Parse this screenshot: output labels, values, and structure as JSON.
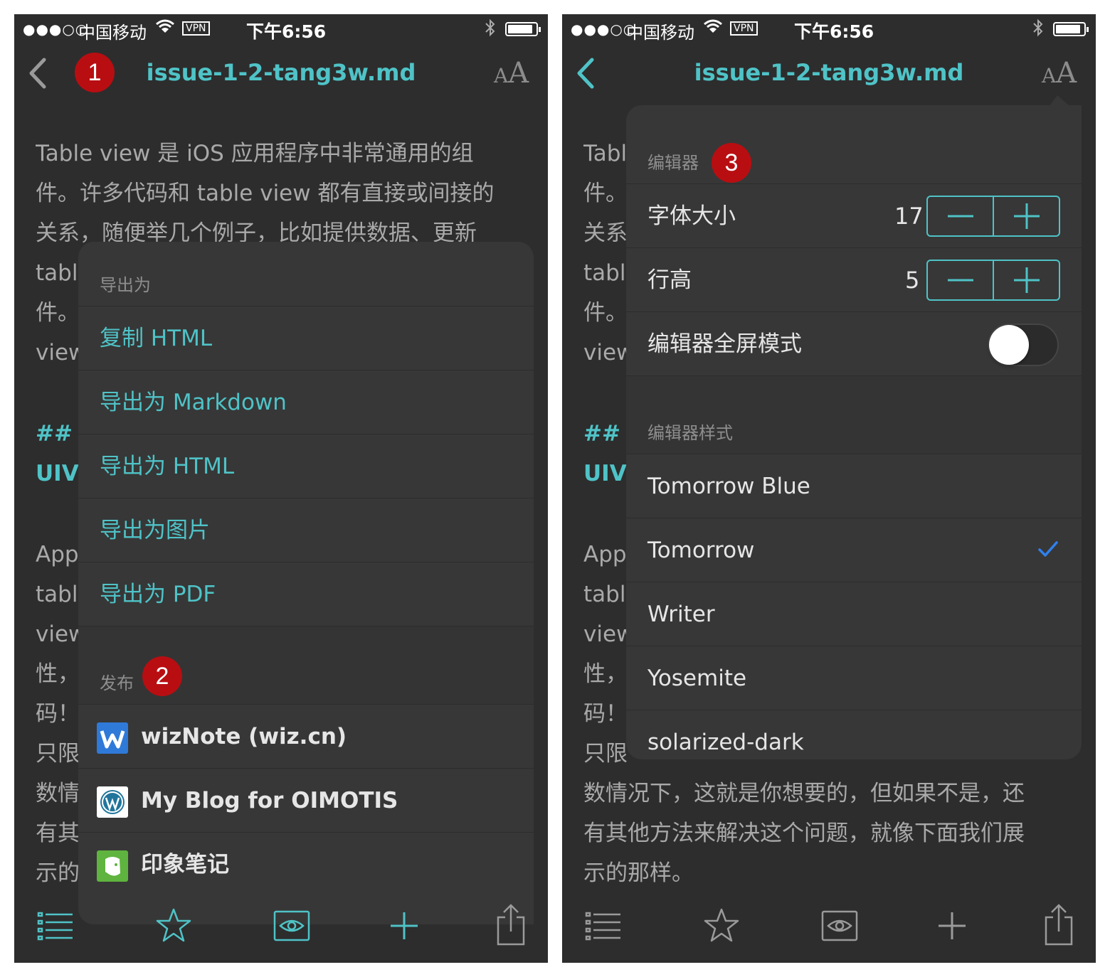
{
  "status": {
    "signal": "●●●○○",
    "carrier": "中国移动",
    "vpn": "VPN",
    "time": "下午6:56"
  },
  "nav": {
    "title": "issue-1-2-tang3w.md",
    "font_button_small": "A",
    "font_button_big": "A"
  },
  "badges": {
    "one": "1",
    "two": "2",
    "three": "3"
  },
  "colors": {
    "accent": "#4fc3c7",
    "badge": "#b80e12",
    "background": "#2d2d2d",
    "check": "#2f80ed"
  },
  "left": {
    "doc_lines": [
      "Table view 是 iOS 应用程序中非常通用的组",
      "件。许多代码和 table view 都有直接或间接的",
      "关系，随便举几个例子，比如提供数据、更新",
      "tabl",
      "件。",
      "view",
      "## U",
      "UIV",
      "App",
      "tabl",
      "view",
      "性，",
      "码！",
      "只限",
      "数情",
      "有其",
      "示的"
    ],
    "export_header": "导出为",
    "export_items": [
      "复制 HTML",
      "导出为 Markdown",
      "导出为 HTML",
      "导出为图片",
      "导出为 PDF"
    ],
    "publish_header": "发布",
    "publish_items": [
      {
        "label": "wizNote (wiz.cn)",
        "icon": "wiznote-icon"
      },
      {
        "label": "My Blog for OIMOTIS",
        "icon": "wordpress-icon"
      },
      {
        "label": "印象笔记",
        "icon": "evernote-icon"
      }
    ]
  },
  "right": {
    "doc_lines": [
      "Tabl",
      "件。",
      "关系",
      "tabl",
      "件。",
      "view",
      "## U",
      "UIV",
      "App",
      "tabl",
      "view",
      "性，",
      "码！",
      "只限",
      "数情况下，这就是你想要的，但如果不是，还",
      "有其他方法来解决这个问题，就像下面我们展",
      "示的那样。"
    ],
    "editor_header": "编辑器",
    "font_size_label": "字体大小",
    "font_size_value": "17",
    "line_height_label": "行高",
    "line_height_value": "5",
    "fullscreen_label": "编辑器全屏模式",
    "fullscreen_on": false,
    "style_header": "编辑器样式",
    "styles": [
      "Tomorrow Blue",
      "Tomorrow",
      "Writer",
      "Yosemite",
      "solarized-dark"
    ],
    "selected_style": "Tomorrow"
  },
  "toolbar": {
    "icons": [
      "list-icon",
      "star-icon",
      "eye-icon",
      "plus-icon",
      "share-icon"
    ]
  }
}
